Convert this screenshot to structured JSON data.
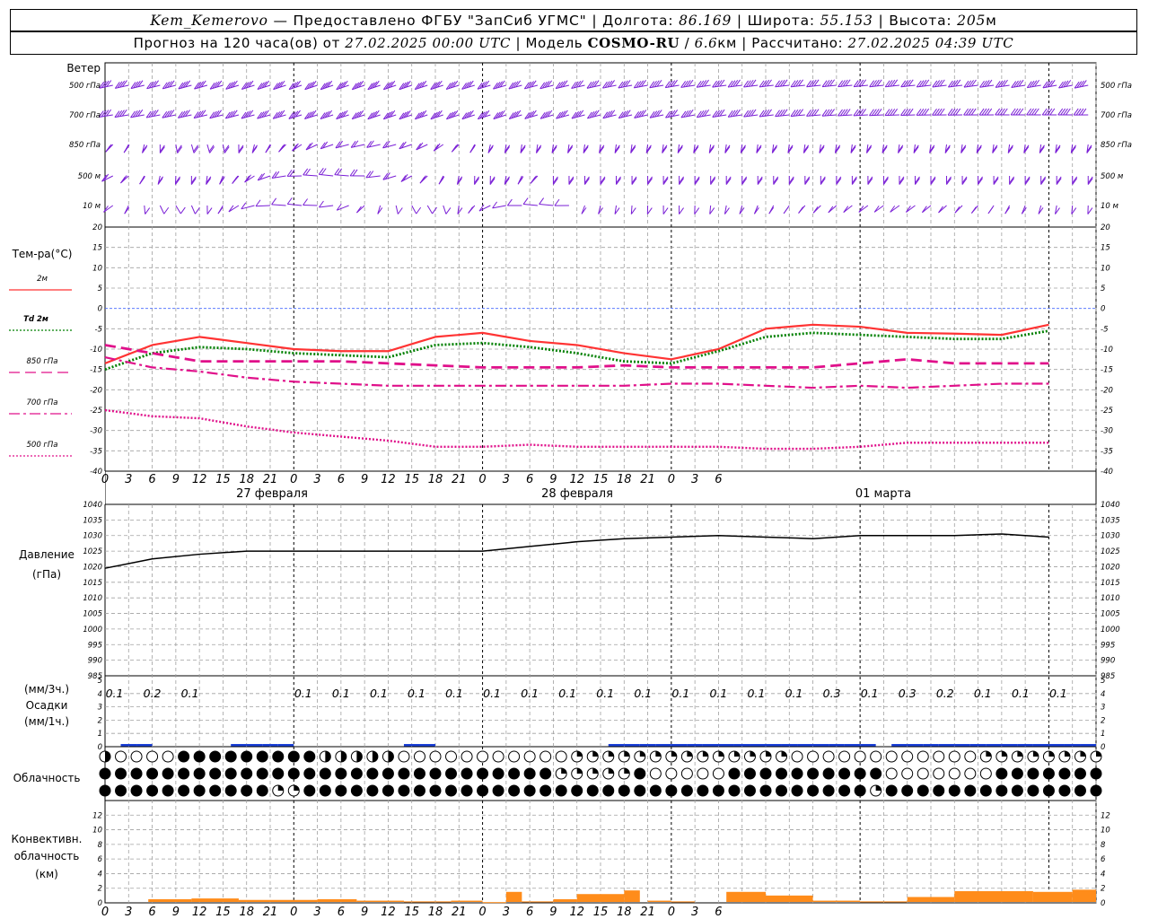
{
  "header": {
    "station": "Kem_Kemerovo",
    "provider": " — Предоставлено ФГБУ \"ЗапСиб УГМС\" | Долгота: ",
    "lon": "86.169",
    "lat_label": " | Широта: ",
    "lat": "55.153",
    "alt_label": " | Высота: ",
    "alt": "205",
    "alt_unit": "м",
    "forecast_label": "Прогноз на 120 часа(ов) от ",
    "forecast_start": "27.02.2025 00:00 UTC",
    "model_label": "  | Модель ",
    "model": "COSMO-RU",
    "model_sep": " / ",
    "resolution": "6.6",
    "res_unit": "км | Рассчитано: ",
    "computed": "27.02.2025 04:39 UTC"
  },
  "panels": {
    "wind": {
      "title": "Ветер",
      "levels": [
        "500 гПа",
        "700 гПа",
        "850 гПа",
        "500  м",
        "10   м"
      ]
    },
    "temperature": {
      "title": "Тем-ра(°C)",
      "ticks": [
        "20",
        "15",
        "10",
        "5",
        "0",
        "-5",
        "-10",
        "-15",
        "-20",
        "-25",
        "-30",
        "-35",
        "-40"
      ],
      "legend": [
        {
          "label": "2м",
          "color": "#ff3333",
          "style": "solid"
        },
        {
          "label": "Td  2м",
          "color": "#008000",
          "style": "dotted"
        },
        {
          "label": "850 гПа",
          "color": "#e0108a",
          "style": "dashed"
        },
        {
          "label": "700 гПа",
          "color": "#e0108a",
          "style": "dashdot"
        },
        {
          "label": "500 гПа",
          "color": "#e0108a",
          "style": "dotted"
        }
      ]
    },
    "pressure": {
      "title": "Давление",
      "unit": "(гПа)",
      "ticks": [
        "1040",
        "1035",
        "1030",
        "1025",
        "1020",
        "1015",
        "1010",
        "1005",
        "1000",
        "995",
        "990",
        "985"
      ]
    },
    "precip": {
      "title": "Осадки",
      "unit_3h": "(мм/3ч.)",
      "unit_1h": "(мм/1ч.)",
      "ticks": [
        "5",
        "4",
        "3",
        "2",
        "1",
        "0"
      ],
      "labels": [
        "0.1",
        "0.2",
        "0.1",
        "",
        "",
        "0.1",
        "0.1",
        "0.1",
        "0.1",
        "0.1",
        "0.1",
        "0.1",
        "0.1",
        "0.1",
        "0.1",
        "0.1",
        "0.1",
        "0.1",
        "0.1",
        "0.3",
        "0.1",
        "0.3",
        "0.2",
        "0.1",
        "0.1",
        "0.1"
      ]
    },
    "cloud": {
      "title": "Облачность"
    },
    "convective": {
      "title1": "Конвективн.",
      "title2": "облачность",
      "unit": "(км)",
      "ticks": [
        "12",
        "10",
        "8",
        "6",
        "4",
        "2",
        "0"
      ]
    }
  },
  "x_ticks": [
    "0",
    "3",
    "6",
    "9",
    "12",
    "15",
    "18",
    "21",
    "0",
    "3",
    "6",
    "9",
    "12",
    "15",
    "18",
    "21",
    "0",
    "3",
    "6",
    "9",
    "12",
    "15",
    "18",
    "21",
    "0",
    "3",
    "6"
  ],
  "dates": [
    "27 февраля",
    "28 февраля",
    "01 марта"
  ],
  "colors": {
    "wind": "#7a1fd6",
    "precip": "#1a3fd6",
    "convective": "#ff8c1a",
    "grid": "#a0a0a0"
  },
  "chart_data": {
    "type": "line",
    "x_hours": [
      0,
      6,
      12,
      18,
      24,
      30,
      36,
      42,
      48,
      54,
      60,
      66,
      72,
      78,
      84,
      90,
      96,
      102,
      108,
      114,
      120
    ],
    "series": [
      {
        "name": "2м",
        "unit": "°C",
        "values": [
          -13.5,
          -9,
          -7,
          -8.5,
          -10,
          -10.5,
          -10.5,
          -7,
          -6,
          -8,
          -9,
          -11,
          -12.5,
          -10,
          -5,
          -4,
          -4.5,
          -6,
          -6.2,
          -6.5,
          -4
        ]
      },
      {
        "name": "Td  2м",
        "unit": "°C",
        "values": [
          -15,
          -11,
          -9.5,
          -10,
          -11,
          -11.5,
          -12,
          -9,
          -8.5,
          -9.5,
          -11,
          -13,
          -13.5,
          -10.5,
          -7,
          -6,
          -6.5,
          -7,
          -7.5,
          -7.5,
          -5.5
        ]
      },
      {
        "name": "850 гПа",
        "unit": "°C",
        "values": [
          -9,
          -11,
          -13,
          -13,
          -13,
          -13,
          -13.5,
          -14,
          -14.5,
          -14.5,
          -14.5,
          -14,
          -14.5,
          -14.5,
          -14.5,
          -14.5,
          -13.5,
          -12.5,
          -13.5,
          -13.5,
          -13.5
        ]
      },
      {
        "name": "700 гПа",
        "unit": "°C",
        "values": [
          -12,
          -14.5,
          -15.5,
          -17,
          -18,
          -18.5,
          -19,
          -19,
          -19,
          -19,
          -19,
          -19,
          -18.5,
          -18.5,
          -19,
          -19.5,
          -19,
          -19.5,
          -19,
          -18.5,
          -18.5
        ]
      },
      {
        "name": "500 гПа",
        "unit": "°C",
        "values": [
          -25,
          -26.5,
          -27,
          -29,
          -30.5,
          -31.5,
          -32.5,
          -34,
          -34,
          -33.5,
          -34,
          -34,
          -34,
          -34,
          -34.5,
          -34.5,
          -34,
          -33,
          -33,
          -33,
          -33
        ]
      },
      {
        "name": "Давление",
        "unit": "гПа",
        "values": [
          1019.5,
          1022.5,
          1024,
          1025,
          1025,
          1025,
          1025,
          1025,
          1025,
          1026.5,
          1028,
          1029,
          1029.5,
          1030,
          1029.5,
          1029,
          1030,
          1030,
          1030,
          1030.5,
          1029.5
        ]
      }
    ],
    "ylim_temp": [
      -40,
      20
    ],
    "ylim_pressure": [
      985,
      1040
    ],
    "xlim_hours": [
      0,
      126
    ]
  }
}
